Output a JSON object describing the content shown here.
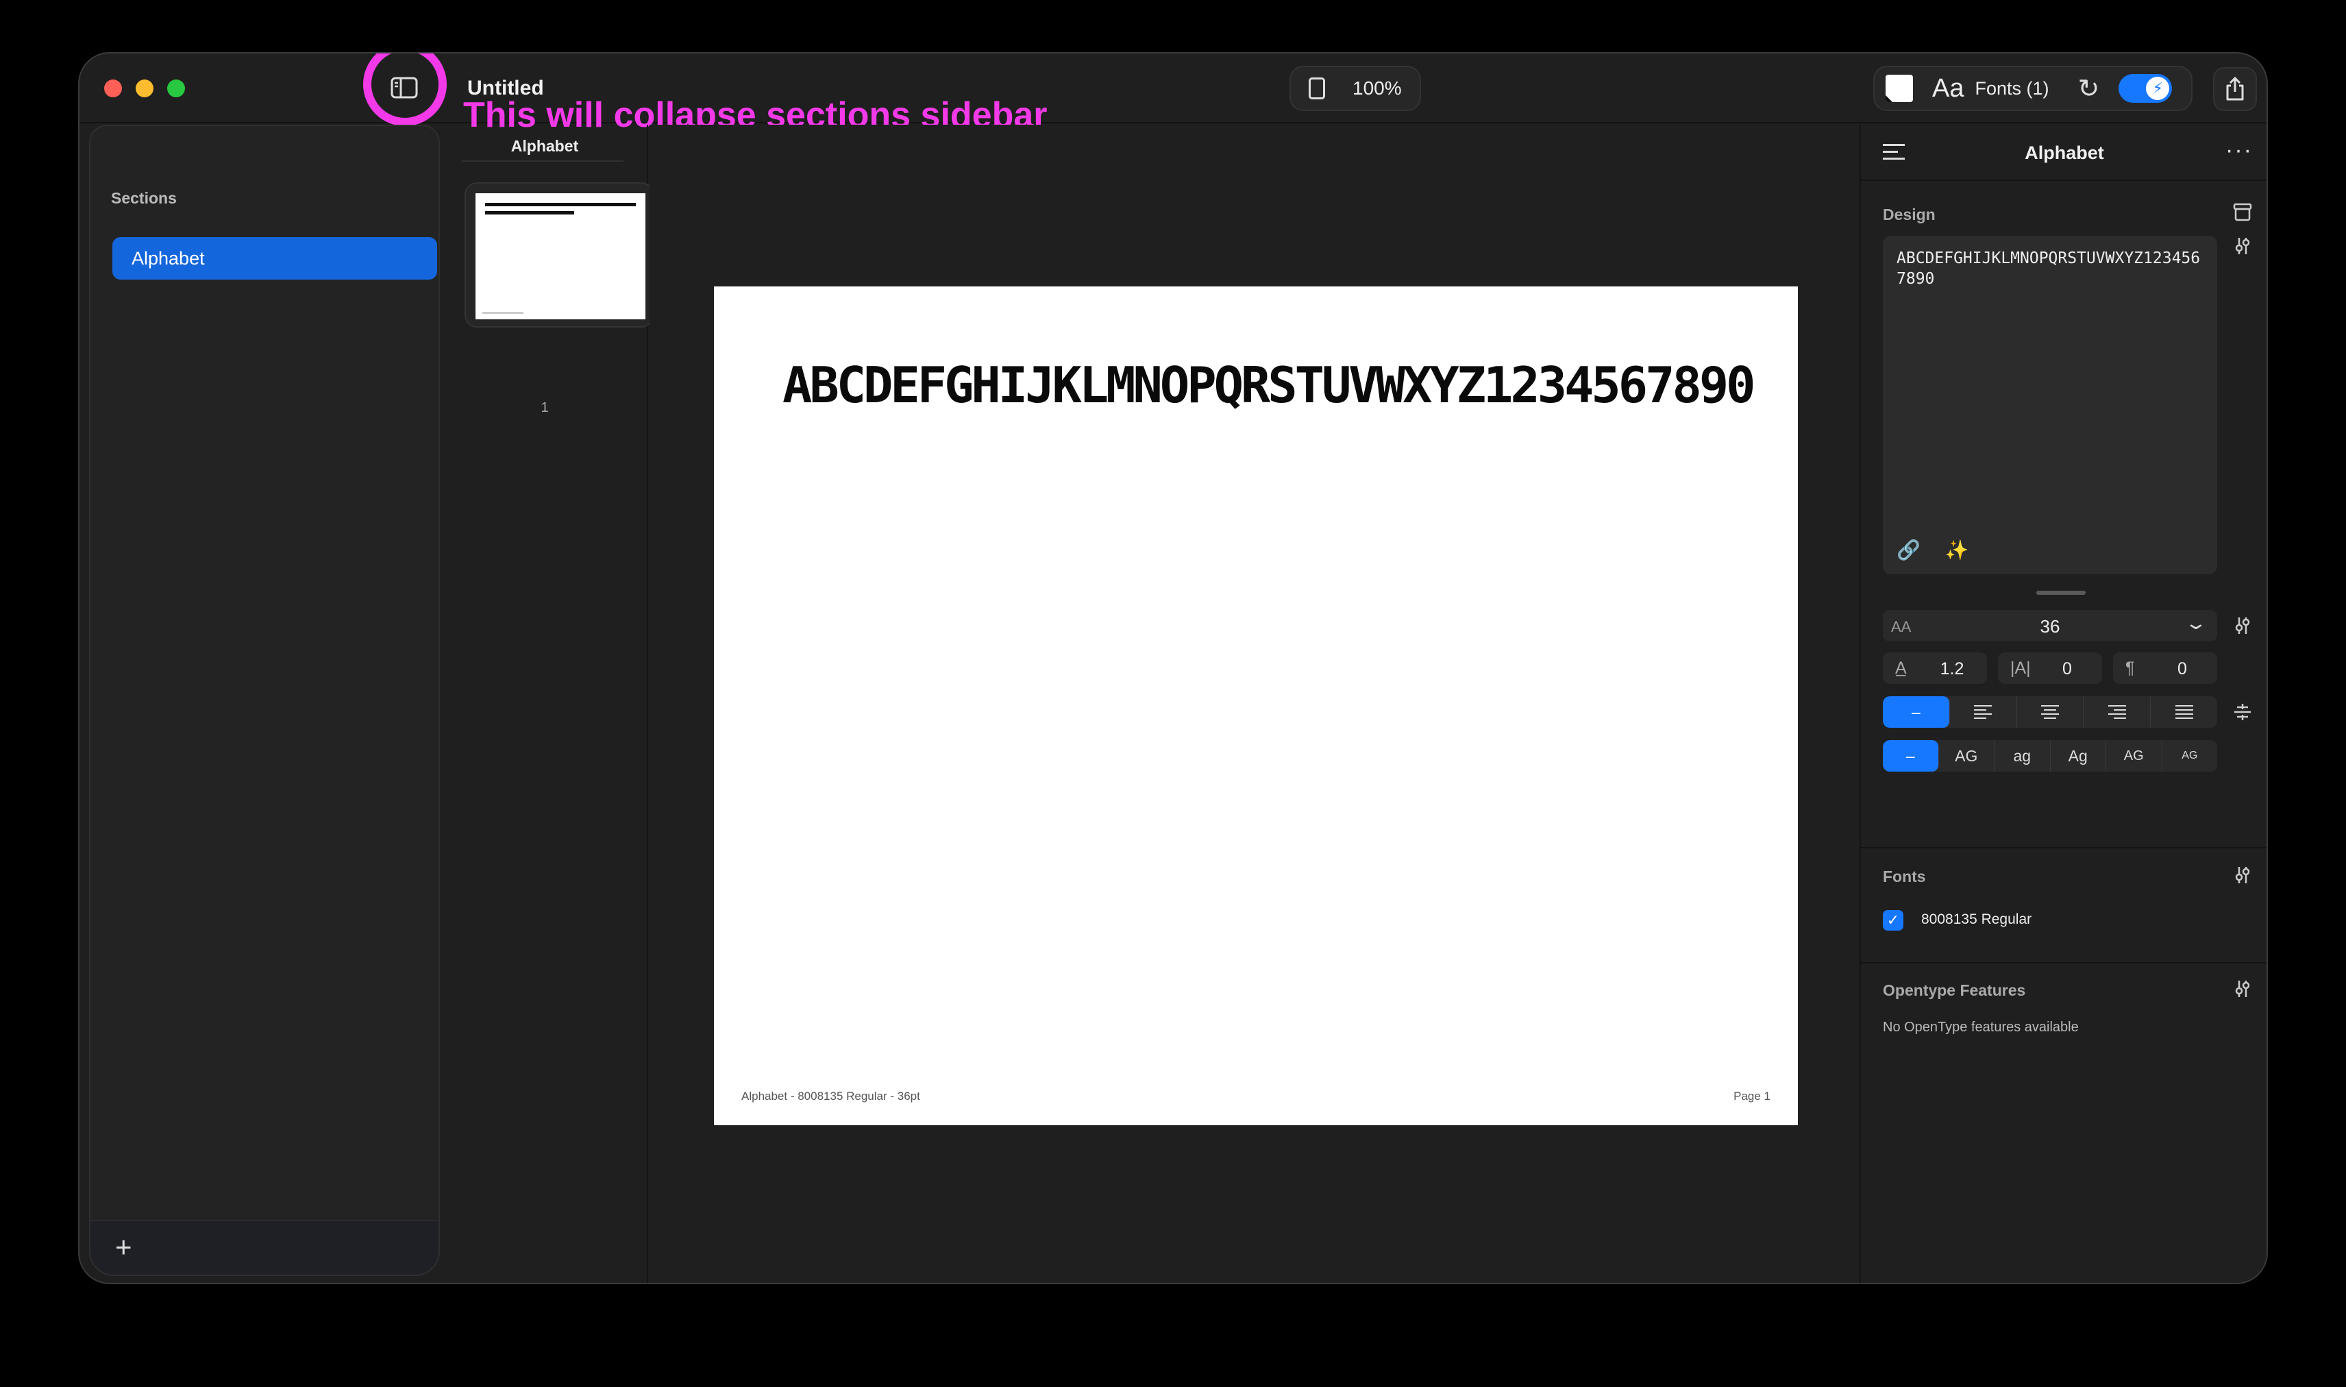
{
  "window": {
    "title": "Untitled",
    "annotation": "This will collapse sections sidebar",
    "zoom": "100%",
    "toolbar": {
      "aa_label": "Aa",
      "fonts_label": "Fonts (1)"
    }
  },
  "sections": {
    "header": "Sections",
    "items": [
      {
        "label": "Alphabet"
      }
    ],
    "add_label": "+"
  },
  "thumbnails": {
    "title": "Alphabet",
    "pages": [
      {
        "number": "1"
      }
    ]
  },
  "canvas": {
    "sample_text": "ABCDEFGHIJKLMNOPQRSTUVWXYZ1234567890",
    "footer_left": "Alphabet - 8008135 Regular - 36pt",
    "footer_right": "Page 1"
  },
  "inspector": {
    "title": "Alphabet",
    "more": "···",
    "design": {
      "label": "Design",
      "text": "ABCDEFGHIJKLMNOPQRSTUVWXYZ1234567890",
      "size_prefix": "AA",
      "font_size": "36",
      "line_height": "1.2",
      "tracking": "0",
      "paragraph": "0",
      "alignment_options": [
        "–",
        "left",
        "center",
        "right",
        "justify"
      ],
      "case_options": [
        "–",
        "AG",
        "ag",
        "Ag",
        "AG",
        "AG"
      ]
    },
    "fonts": {
      "label": "Fonts",
      "items": [
        {
          "name": "8008135 Regular",
          "checked": true
        }
      ]
    },
    "opentype": {
      "label": "Opentype Features",
      "empty_text": "No OpenType features available"
    }
  },
  "colors": {
    "accent": "#1677ff",
    "annotation": "#f43ae8",
    "selection": "#1466dd"
  }
}
